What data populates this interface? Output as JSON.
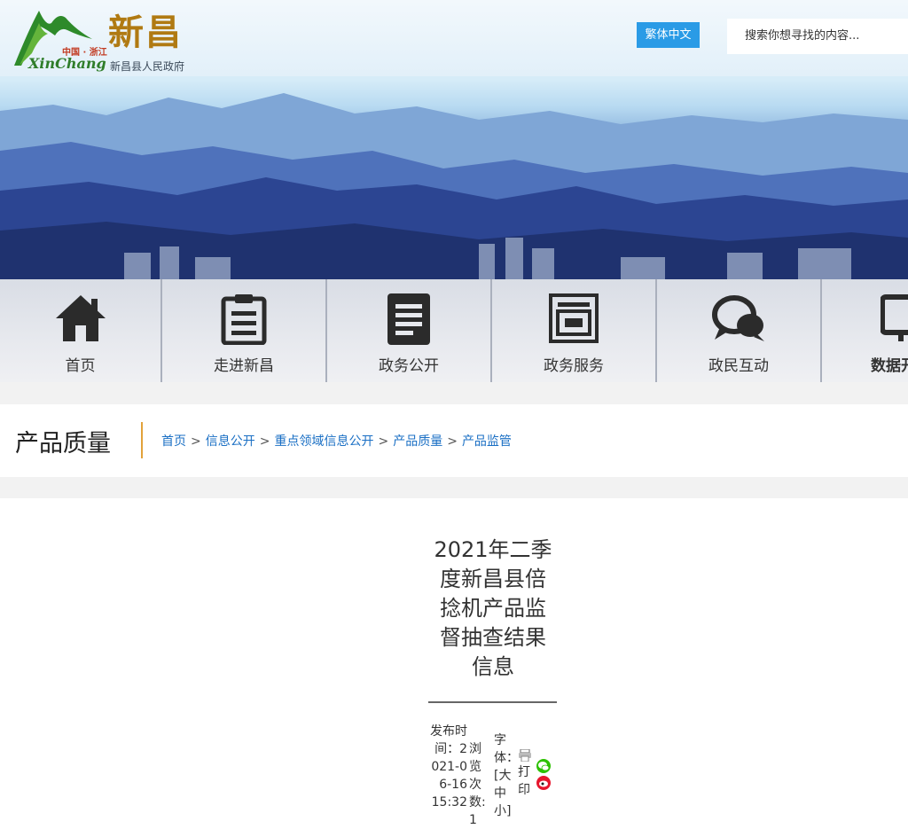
{
  "header": {
    "logo_sub": "中国 · 浙江",
    "logo_latin": "XinChang",
    "logo_cn": "新昌",
    "logo_gov": "新昌县人民政府",
    "traditional_label": "繁体中文",
    "search_placeholder": "搜索你想寻找的内容..."
  },
  "nav": {
    "items": [
      {
        "label": "首页",
        "icon": "home-icon"
      },
      {
        "label": "走进新昌",
        "icon": "clipboard-icon"
      },
      {
        "label": "政务公开",
        "icon": "document-icon"
      },
      {
        "label": "政务服务",
        "icon": "service-window-icon"
      },
      {
        "label": "政民互动",
        "icon": "chat-bubble-icon"
      },
      {
        "label": "数据开",
        "icon": "monitor-icon"
      }
    ]
  },
  "section": {
    "title": "产品质量",
    "breadcrumb": [
      "首页",
      "信息公开",
      "重点领域信息公开",
      "产品质量",
      "产品监管"
    ],
    "separator": ">"
  },
  "article": {
    "title": "2021年二季度新昌县倍捻机产品监督抽查结果信息",
    "publish_text": "发布时间：2021-06-16 15:32",
    "views_text": "浏览次数:1",
    "font_label": "字体：[",
    "font_large": "大",
    "font_medium": "中",
    "font_small": "小",
    "font_close": "]",
    "print_label": "打印",
    "share": [
      "wechat-icon",
      "weibo-icon"
    ]
  },
  "colors": {
    "accent_blue": "#2a9be6",
    "link_blue": "#1a6fc4",
    "title_bar": "#e2a23b",
    "wechat": "#2dc100",
    "weibo": "#e6162d"
  }
}
